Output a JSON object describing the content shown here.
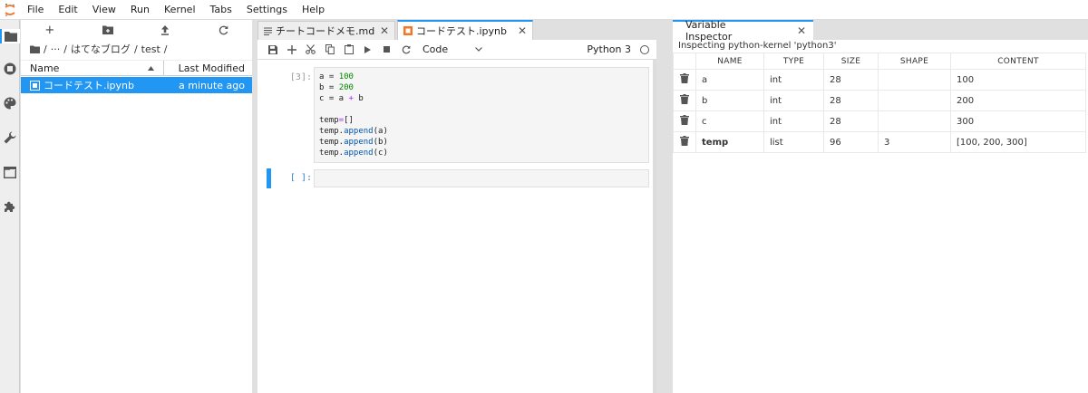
{
  "menubar": {
    "items": [
      "File",
      "Edit",
      "View",
      "Run",
      "Kernel",
      "Tabs",
      "Settings",
      "Help"
    ]
  },
  "activitybar": {
    "icons": [
      "folder-icon",
      "running-icon",
      "palette-icon",
      "wrench-icon",
      "tabs-icon",
      "extension-icon"
    ]
  },
  "filebrowser": {
    "toolbar": [
      "+",
      "new-folder-icon",
      "upload-icon",
      "refresh-icon"
    ],
    "breadcrumb": {
      "sep1": "/",
      "ellipsis": "···",
      "sep2": "/",
      "folder1": "はてなブログ",
      "sep3": "/",
      "folder2": "test",
      "sep4": "/"
    },
    "columns": {
      "name": "Name",
      "modified": "Last Modified"
    },
    "files": [
      {
        "name": "コードテスト.ipynb",
        "modified": "a minute ago"
      }
    ]
  },
  "notebook": {
    "tabs": [
      {
        "label": "チートコードメモ.md",
        "active": false
      },
      {
        "label": "コードテスト.ipynb",
        "active": true
      }
    ],
    "cell_type": "Code",
    "kernel": "Python 3",
    "cells": [
      {
        "prompt": "[3]:",
        "lines": [
          "a = 100",
          "b = 200",
          "c = a + b",
          "",
          "temp=[]",
          "temp.append(a)",
          "temp.append(b)",
          "temp.append(c)"
        ]
      },
      {
        "prompt": "[ ]:",
        "lines": []
      }
    ]
  },
  "inspector": {
    "tab_label": "Variable Inspector",
    "subtitle": "Inspecting python-kernel 'python3'",
    "columns": [
      "NAME",
      "TYPE",
      "SIZE",
      "SHAPE",
      "CONTENT"
    ],
    "rows": [
      {
        "name": "a",
        "type": "int",
        "size": "28",
        "shape": "",
        "content": "100"
      },
      {
        "name": "b",
        "type": "int",
        "size": "28",
        "shape": "",
        "content": "200"
      },
      {
        "name": "c",
        "type": "int",
        "size": "28",
        "shape": "",
        "content": "300"
      },
      {
        "name": "temp",
        "type": "list",
        "size": "96",
        "shape": "3",
        "content": "[100, 200, 300]"
      }
    ]
  },
  "colors": {
    "accent": "#2196f3",
    "logo": "#f37726"
  }
}
